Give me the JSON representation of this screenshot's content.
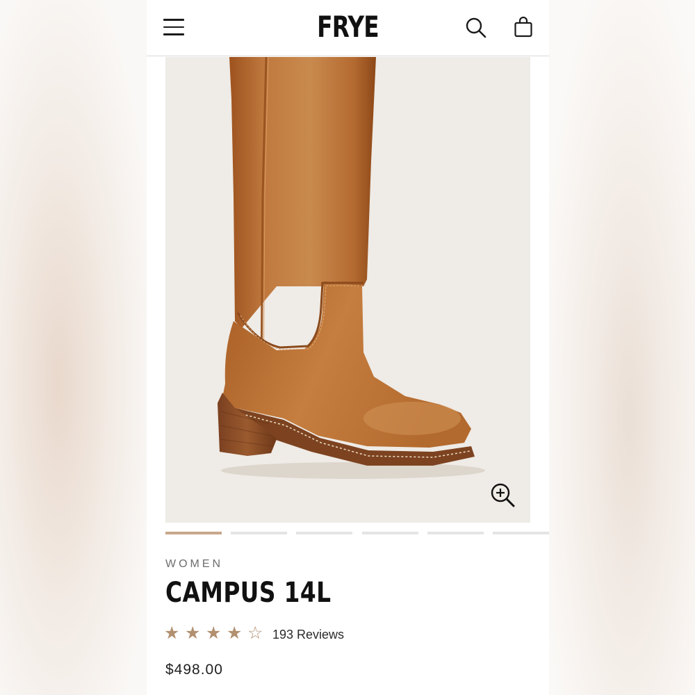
{
  "header": {
    "logo": "FRYE",
    "menu_icon": "hamburger-menu-icon",
    "search_icon": "search-icon",
    "bag_icon": "shopping-bag-icon"
  },
  "gallery": {
    "image": "tan-leather-tall-boot",
    "zoom_icon": "zoom-in-icon",
    "slide_count": 6,
    "active_slide": 1,
    "colors": {
      "boot": "#b86a2f",
      "background": "#efebe6",
      "active_dot": "#c8a88a"
    }
  },
  "product": {
    "category": "WOMEN",
    "name": "CAMPUS 14L",
    "rating": 4,
    "rating_max": 5,
    "reviews_label": "193 Reviews",
    "price": "$498.00",
    "star_color": "#b29070"
  }
}
